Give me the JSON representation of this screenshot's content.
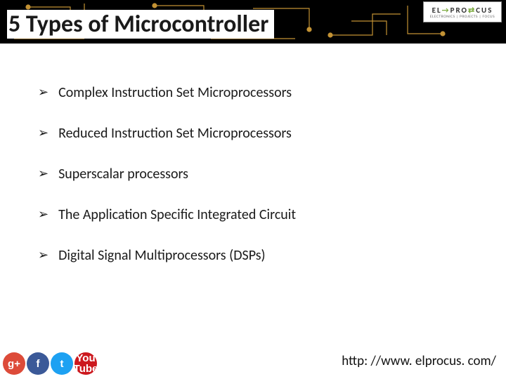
{
  "title": "5 Types of Microcontroller",
  "logo": {
    "top_left": "EL",
    "top_right": "PRO",
    "top_end": "CUS",
    "sub": "ELECTRONICS | PROJECTS | FOCUS"
  },
  "items": [
    "Complex Instruction Set Microprocessors",
    "Reduced Instruction Set Microprocessors",
    "Superscalar processors",
    "The Application Specific Integrated Circuit",
    "Digital Signal Multiprocessors (DSPs)"
  ],
  "social": {
    "gplus": "g+",
    "fb": "f",
    "tw": "t",
    "yt": "You\nTube"
  },
  "url": "http: //www. elprocus. com/",
  "bullet": "➢"
}
